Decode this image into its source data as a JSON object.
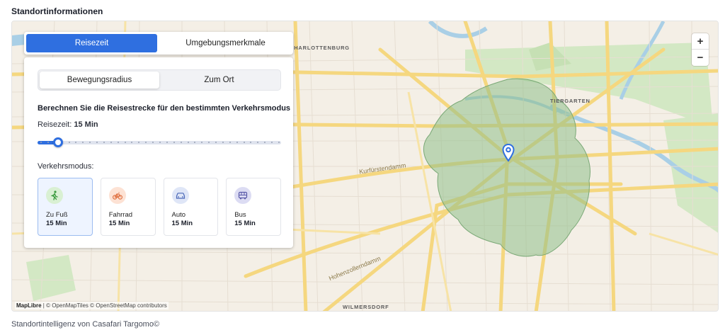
{
  "section": {
    "title": "Standortinformationen"
  },
  "map": {
    "district_labels": [
      "CHARLOTTENBURG",
      "TIERGARTEN",
      "WILMERSDORF"
    ],
    "street_labels": [
      "Kurfürstendamm",
      "Hohenzollerndamm"
    ],
    "zoom_in": "+",
    "zoom_out": "−",
    "attribution_brand": "MapLibre",
    "attribution_text": " | © OpenMapTiles © OpenStreetMap contributors",
    "isochrone_color": "#8fbf8a",
    "marker_color": "#2f6fe0"
  },
  "panel": {
    "tabs": [
      "Reisezeit",
      "Umgebungsmerkmale"
    ],
    "active_tab": "Reisezeit",
    "segments": [
      "Bewegungsradius",
      "Zum Ort"
    ],
    "heading": "Berechnen Sie die Reisestrecke für den bestimmten Verkehrsmodus",
    "time_label": "Reisezeit:",
    "time_value": "15 Min",
    "slider_fraction": 0.083,
    "modes_label": "Verkehrsmodus:",
    "modes": [
      {
        "name": "Zu Fuß",
        "duration": "15 Min",
        "icon": "walk-icon",
        "color": "#d9f0d3",
        "accent": "#3b9b3f"
      },
      {
        "name": "Fahrrad",
        "duration": "15 Min",
        "icon": "bicycle-icon",
        "color": "#fde2d4",
        "accent": "#e07040"
      },
      {
        "name": "Auto",
        "duration": "15 Min",
        "icon": "car-icon",
        "color": "#dfe6f7",
        "accent": "#4a68b8"
      },
      {
        "name": "Bus",
        "duration": "15 Min",
        "icon": "bus-icon",
        "color": "#dcdcf3",
        "accent": "#5858a8"
      }
    ]
  },
  "footer": {
    "text": "Standortintelligenz von Casafari Targomo©"
  }
}
